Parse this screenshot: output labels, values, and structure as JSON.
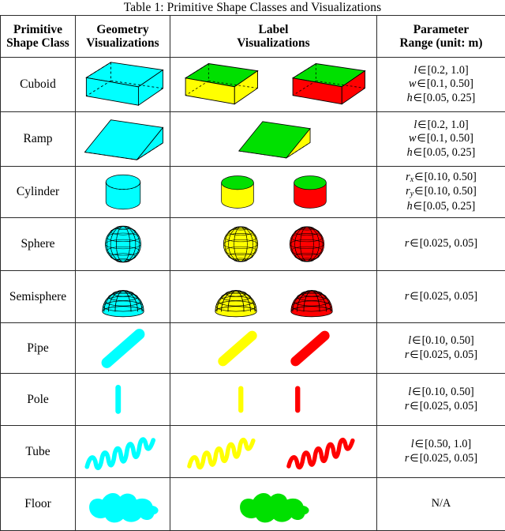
{
  "caption": "Table 1: Primitive Shape Classes and Visualizations",
  "headers": [
    {
      "line1": "Primitive",
      "line2": "Shape Class"
    },
    {
      "line1": "Geometry",
      "line2": "Visualizations"
    },
    {
      "line1": "Label",
      "line2": "Visualizations"
    },
    {
      "line1": "Parameter",
      "line2": "Range (unit: m)"
    }
  ],
  "colors": {
    "geometry": "#00FFFF",
    "label_top": "#00E000",
    "label_a": "#FFFF00",
    "label_b": "#FF0000",
    "border": "#2b2b2b",
    "edge": "#000000"
  },
  "rows": [
    {
      "name": "Cuboid",
      "geometry_shape": "cuboid",
      "label_shapes": [
        "cuboid-yellow",
        "cuboid-red"
      ],
      "params": [
        {
          "var": "l",
          "sub": "",
          "op": "∈",
          "range": "[0.2, 1.0]"
        },
        {
          "var": "w",
          "sub": "",
          "op": "∈",
          "range": "[0.1, 0.50]"
        },
        {
          "var": "h",
          "sub": "",
          "op": "∈",
          "range": "[0.05, 0.25]"
        }
      ]
    },
    {
      "name": "Ramp",
      "geometry_shape": "ramp",
      "label_shapes": [
        "ramp-green"
      ],
      "params": [
        {
          "var": "l",
          "sub": "",
          "op": "∈",
          "range": "[0.2, 1.0]"
        },
        {
          "var": "w",
          "sub": "",
          "op": "∈",
          "range": "[0.1, 0.50]"
        },
        {
          "var": "h",
          "sub": "",
          "op": "∈",
          "range": "[0.05, 0.25]"
        }
      ]
    },
    {
      "name": "Cylinder",
      "geometry_shape": "cylinder",
      "label_shapes": [
        "cylinder-yellow",
        "cylinder-red"
      ],
      "params": [
        {
          "var": "r",
          "sub": "x",
          "op": "∈",
          "range": "[0.10, 0.50]"
        },
        {
          "var": "r",
          "sub": "y",
          "op": "∈",
          "range": "[0.10, 0.50]"
        },
        {
          "var": "h",
          "sub": "",
          "op": "∈",
          "range": "[0.05, 0.25]"
        }
      ]
    },
    {
      "name": "Sphere",
      "geometry_shape": "sphere",
      "label_shapes": [
        "sphere-yellow",
        "sphere-red"
      ],
      "params": [
        {
          "var": "r",
          "sub": "",
          "op": "∈",
          "range": "[0.025, 0.05]"
        }
      ]
    },
    {
      "name": "Semisphere",
      "geometry_shape": "semisphere",
      "label_shapes": [
        "semisphere-yellow",
        "semisphere-red"
      ],
      "params": [
        {
          "var": "r",
          "sub": "",
          "op": "∈",
          "range": "[0.025, 0.05]"
        }
      ]
    },
    {
      "name": "Pipe",
      "geometry_shape": "pipe",
      "label_shapes": [
        "pipe-yellow",
        "pipe-red"
      ],
      "spread": true,
      "params": [
        {
          "var": "l",
          "sub": "",
          "op": "∈",
          "range": "[0.10, 0.50]"
        },
        {
          "var": "r",
          "sub": "",
          "op": "∈",
          "range": "[0.025, 0.05]"
        }
      ]
    },
    {
      "name": "Pole",
      "geometry_shape": "pole",
      "label_shapes": [
        "pole-yellow",
        "pole-red"
      ],
      "spread": true,
      "params": [
        {
          "var": "l",
          "sub": "",
          "op": "∈",
          "range": "[0.10, 0.50]"
        },
        {
          "var": "r",
          "sub": "",
          "op": "∈",
          "range": "[0.025, 0.05]"
        }
      ]
    },
    {
      "name": "Tube",
      "geometry_shape": "tube",
      "label_shapes": [
        "tube-yellow",
        "tube-red"
      ],
      "spread": true,
      "params": [
        {
          "var": "l",
          "sub": "",
          "op": "∈",
          "range": "[0.50, 1.0]"
        },
        {
          "var": "r",
          "sub": "",
          "op": "∈",
          "range": "[0.025, 0.05]"
        }
      ]
    },
    {
      "name": "Floor",
      "geometry_shape": "floor",
      "label_shapes": [
        "floor-green"
      ],
      "params": [],
      "na_text": "N/A"
    }
  ]
}
